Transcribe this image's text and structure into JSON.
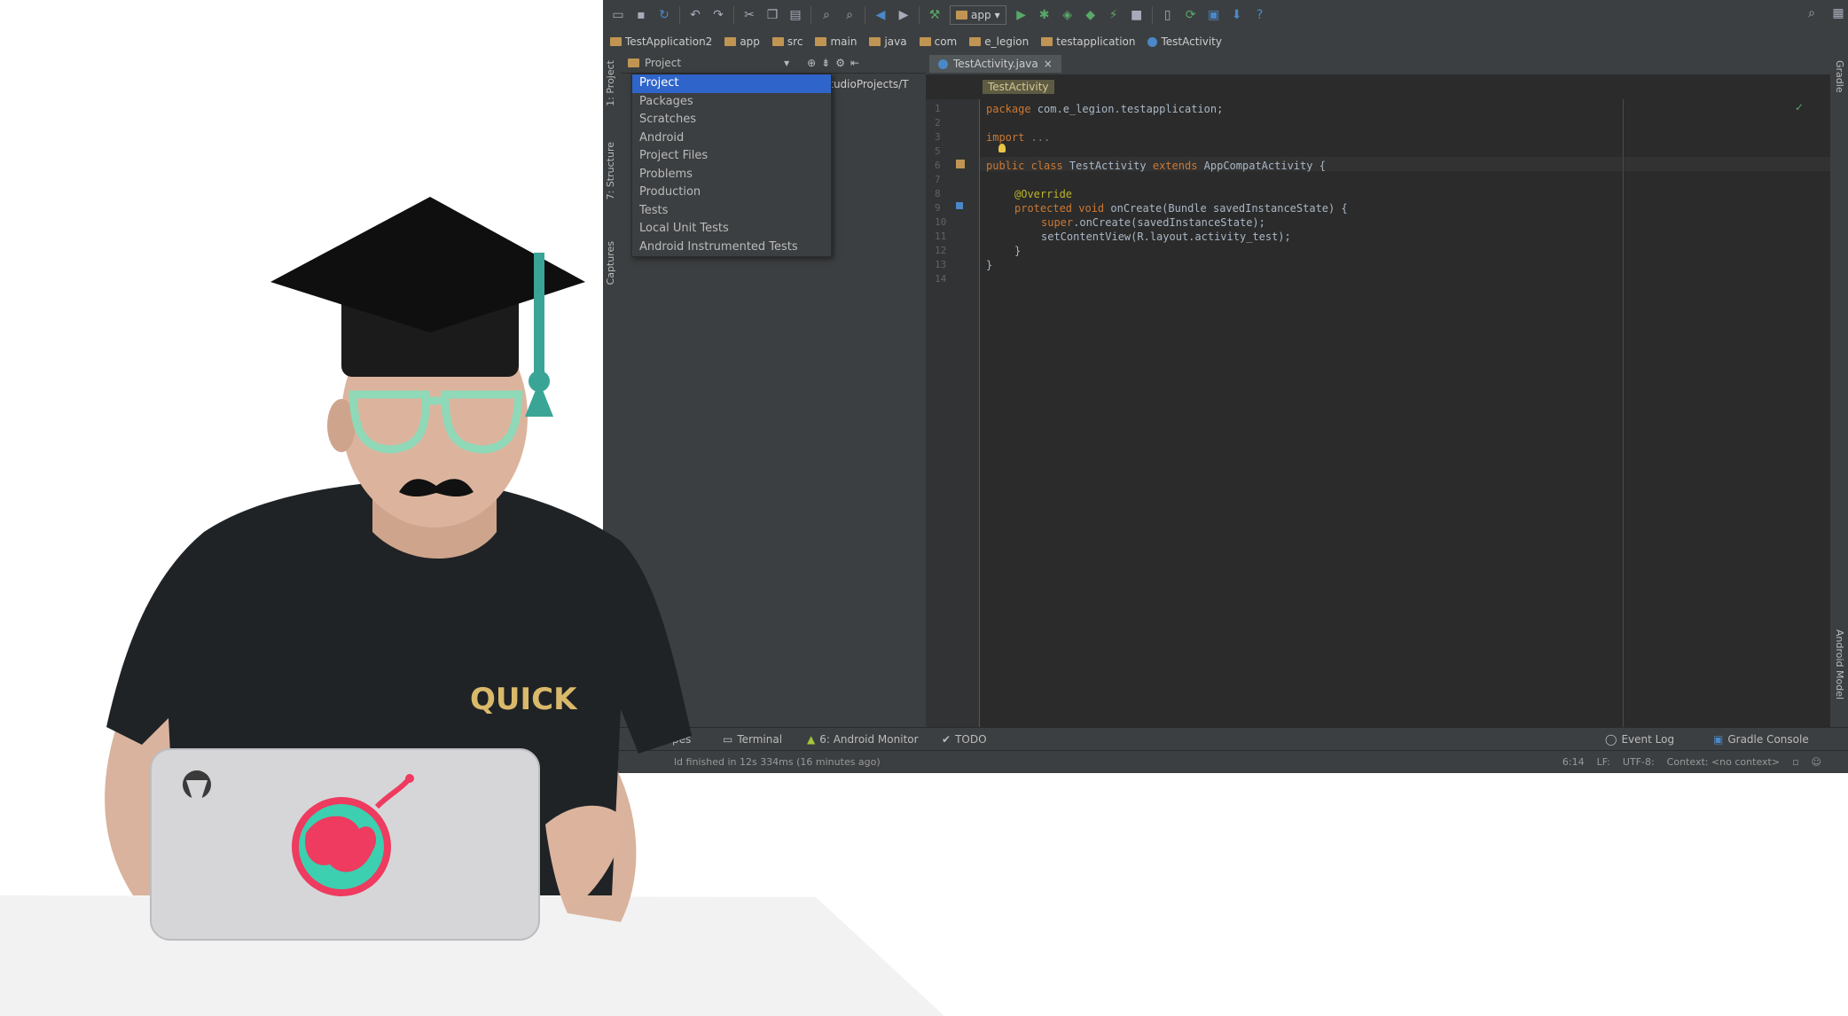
{
  "toolbar": {
    "run_config": "app",
    "help": "?"
  },
  "navbar": {
    "crumbs": [
      "TestApplication2",
      "app",
      "src",
      "main",
      "java",
      "com",
      "e_legion",
      "testapplication",
      "TestActivity"
    ]
  },
  "left_strip": {
    "tabs": [
      "1: Project",
      "7: Structure",
      "Captures"
    ]
  },
  "right_strip": {
    "tabs": [
      "Gradle",
      "Android Model"
    ]
  },
  "project_panel": {
    "view_selector": "Project",
    "path_fragment": "dStudioProjects/T",
    "dropdown": [
      "Project",
      "Packages",
      "Scratches",
      "Android",
      "Project Files",
      "Problems",
      "Production",
      "Tests",
      "Local Unit Tests",
      "Android Instrumented Tests"
    ],
    "selected": "Project"
  },
  "editor": {
    "tab_label": "TestActivity.java",
    "class_crumb": "TestActivity",
    "line_numbers": [
      "1",
      "2",
      "3",
      "5",
      "6",
      "7",
      "8",
      "9",
      "10",
      "11",
      "12",
      "13",
      "14"
    ],
    "lines": {
      "l1_kw": "package",
      "l1_rest": " com.e_legion.testapplication;",
      "l3_kw": "import",
      "l3_rest": " ...",
      "l6_kw": "public class",
      "l6_name": " TestActivity ",
      "l6_kw2": "extends",
      "l6_rest": " AppCompatActivity {",
      "l8_ann": "@Override",
      "l9_kw": "protected void",
      "l9_rest": " onCreate(Bundle savedInstanceState) {",
      "l10_kw": "super",
      "l10_rest": ".onCreate(savedInstanceState);",
      "l11": "setContentView(R.layout.activity_test);",
      "l12": "}",
      "l13": "}"
    }
  },
  "bottom_bar": {
    "left_fragment": "pes",
    "terminal": "Terminal",
    "android_monitor": "6: Android Monitor",
    "todo": "TODO",
    "event_log": "Event Log",
    "gradle_console": "Gradle Console"
  },
  "status_bar": {
    "message": "ld finished in 12s 334ms (16 minutes ago)",
    "position": "6:14",
    "line_sep": "LF:",
    "encoding": "UTF-8:",
    "context": "Context: <no context>"
  },
  "scene": {
    "shirt_text": "QUICK"
  },
  "colors": {
    "ide_bg": "#3c3f41",
    "editor_bg": "#2b2b2b",
    "selection": "#2f65ca",
    "keyword": "#cc7832",
    "annotation": "#bbb529",
    "glasses": "#8fd8b8",
    "tassel": "#3aa596",
    "globe_sea": "#3ccfb0",
    "globe_land": "#ee3b5f"
  }
}
